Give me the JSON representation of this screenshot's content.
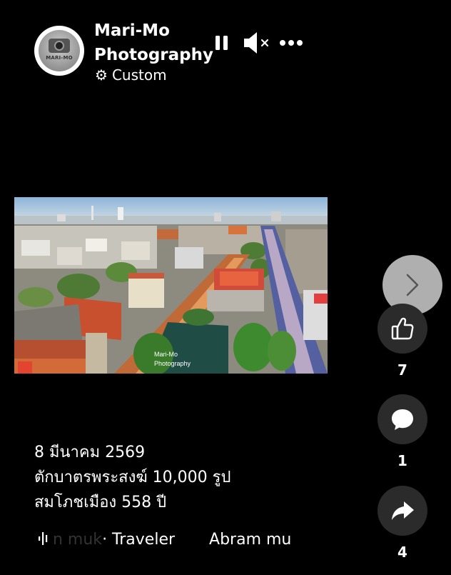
{
  "header": {
    "page_name": "Mari-Mo Photography",
    "privacy_label": "Custom",
    "avatar_text": "MARI-MO"
  },
  "controls": {
    "pause_icon": "pause-icon",
    "mute_icon": "muted-speaker-icon",
    "more_icon": "more-horizontal-icon"
  },
  "video": {
    "watermark_line1": "Mari-Mo",
    "watermark_line2": "Photography"
  },
  "actions": {
    "like_count": "7",
    "comment_count": "1",
    "share_count": "4"
  },
  "caption": {
    "line1": "8 มีนาคม 2569",
    "line2": "ตักบาตรพระสงฆ์ 10,000 รูป",
    "line3": "สมโภชเมือง 558 ปี"
  },
  "audio": {
    "faded_text": "n muk",
    "text1": " · Traveler",
    "text2": "Abram mu"
  },
  "colors": {
    "background": "#000000",
    "action_circle": "#2b2b2b",
    "next_button": "#bebebe"
  }
}
